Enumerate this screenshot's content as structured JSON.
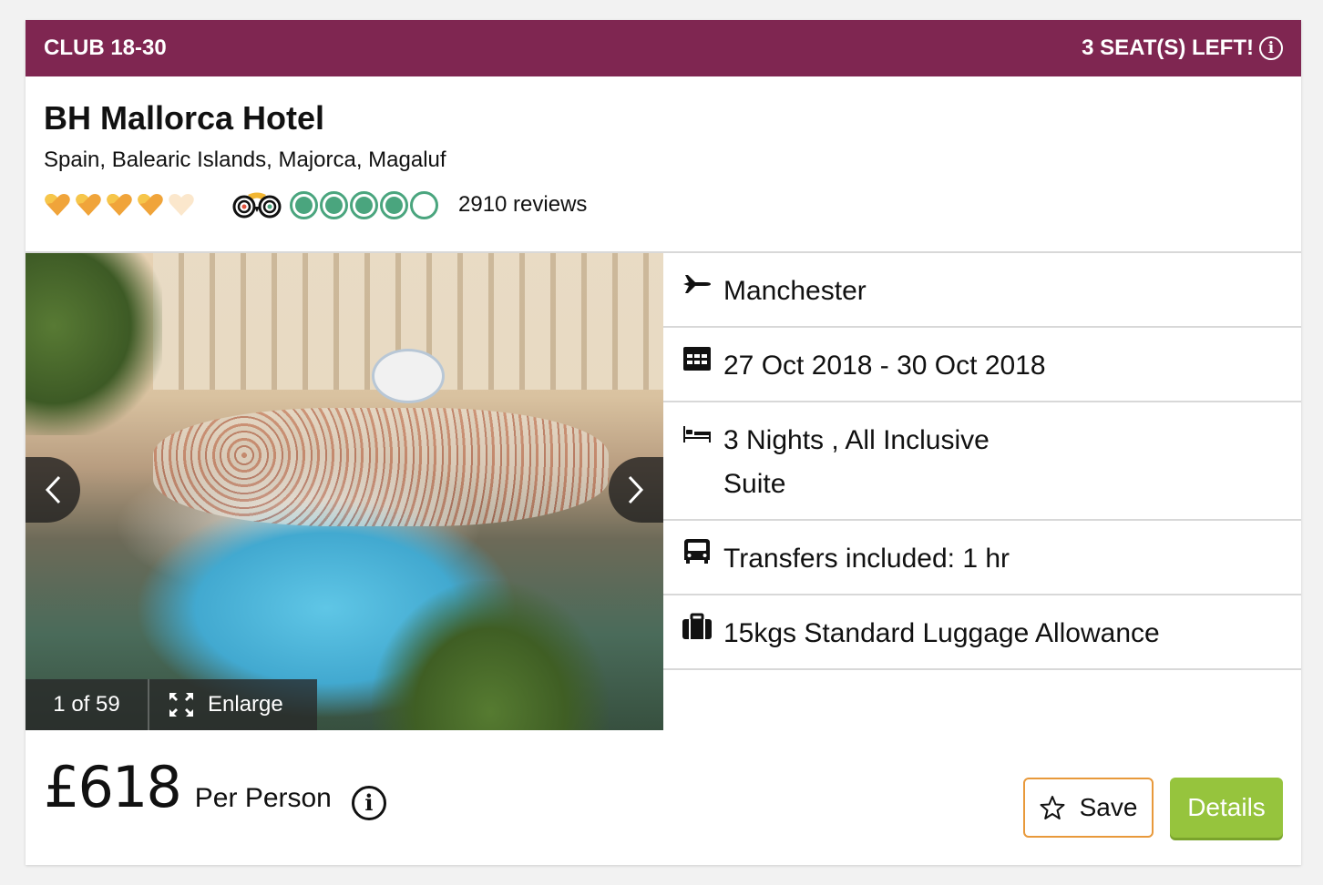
{
  "banner": {
    "brand": "CLUB 18-30",
    "seats_left": "3 SEAT(S) LEFT!",
    "info_icon": "info-circle-icon"
  },
  "hotel": {
    "name": "BH Mallorca Hotel",
    "location": "Spain, Balearic Islands, Majorca, Magaluf",
    "heart_rating": {
      "value": 4,
      "max": 5
    },
    "tripadvisor_rating": {
      "value": 4,
      "max": 5
    },
    "reviews": "2910 reviews"
  },
  "gallery": {
    "counter": "1 of 59",
    "enlarge_label": "Enlarge",
    "prev_icon": "chevron-left-icon",
    "next_icon": "chevron-right-icon"
  },
  "details": [
    {
      "icon": "plane-icon",
      "text": "Manchester"
    },
    {
      "icon": "calendar-icon",
      "text": "27 Oct 2018 - 30 Oct 2018"
    },
    {
      "icon": "bed-icon",
      "text": "3 Nights , All Inclusive",
      "subtext": "Suite"
    },
    {
      "icon": "bus-icon",
      "text": "Transfers included: 1 hr"
    },
    {
      "icon": "luggage-icon",
      "text": "15kgs Standard Luggage Allowance"
    }
  ],
  "pricing": {
    "amount": "£618",
    "per": "Per Person"
  },
  "actions": {
    "save_label": "Save",
    "details_label": "Details"
  },
  "colors": {
    "banner": "#7f2651",
    "heart": "#f0a43a",
    "tripadvisor_green": "#4aa57e",
    "save_border": "#e8993b",
    "details_button": "#96c43d"
  }
}
